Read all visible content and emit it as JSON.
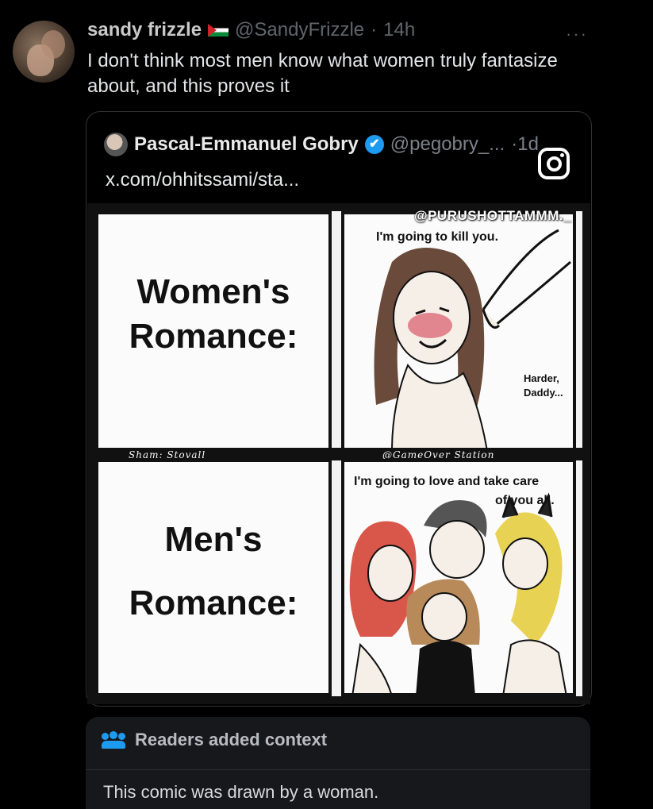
{
  "tweet": {
    "author_name": "sandy frizzle",
    "handle": "@SandyFrizzle",
    "separator": "·",
    "time": "14h",
    "more_label": "···",
    "text": "I don't think most men know what women truly fantasize about, and this proves it"
  },
  "quoted": {
    "author_name": "Pascal-Emmanuel Gobry",
    "verified_icon": "✔",
    "handle": "@pegobry_...",
    "time": "·1d",
    "link_text": "x.com/ohhitssami/sta..."
  },
  "overlay": {
    "watermark": "@PURUSHOTTAMMM._",
    "instagram_icon": "instagram-icon"
  },
  "comic": {
    "top_label": "Women's Romance:",
    "top_label_line1": "Women's",
    "top_label_line2": "Romance:",
    "top_speech": "I'm going to kill you.",
    "top_reply": "Harder, Daddy...",
    "top_reply_line1": "Harder,",
    "top_reply_line2": "Daddy...",
    "credit_left": "Sham: Stovall",
    "credit_right": "@GameOver Station",
    "bottom_label_line1": "Men's",
    "bottom_label_line2": "Romance:",
    "bottom_speech_line1": "I'm going to love and take care",
    "bottom_speech_line2": "of you all."
  },
  "context": {
    "title": "Readers added context",
    "body": "This comic was drawn by a woman."
  },
  "colors": {
    "background": "#000000",
    "accent": "#1d9bf0",
    "context_bg": "#16181c"
  }
}
